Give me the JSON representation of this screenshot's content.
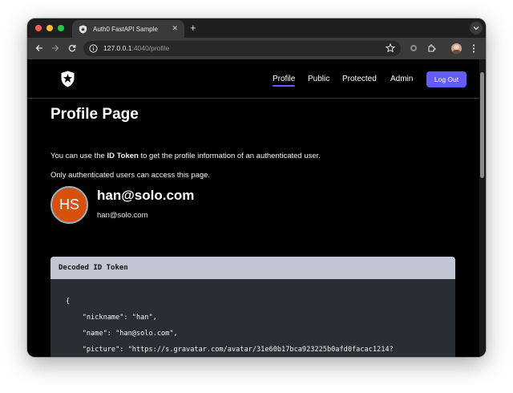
{
  "browser": {
    "tab_title": "Auth0 FastAPI Sample",
    "url_host": "127.0.0.1",
    "url_rest": ":4040/profile"
  },
  "nav": {
    "items": [
      {
        "label": "Profile",
        "active": true
      },
      {
        "label": "Public"
      },
      {
        "label": "Protected"
      },
      {
        "label": "Admin"
      }
    ],
    "logout_label": "Log Out"
  },
  "page": {
    "title": "Profile Page",
    "intro_before": "You can use the ",
    "intro_bold": "ID Token",
    "intro_after": " to get the profile information of an authenticated user.",
    "note": "Only authenticated users can access this page."
  },
  "profile": {
    "initials": "HS",
    "name": "han@solo.com",
    "email": "han@solo.com"
  },
  "token": {
    "header": "Decoded ID Token",
    "lines": [
      "{",
      "    \"nickname\": \"han\",",
      "    \"name\": \"han@solo.com\",",
      "    \"picture\": \"https://s.gravatar.com/avatar/31e60b17bca923225b0afd0facac1214?"
    ]
  },
  "colors": {
    "accent": "#635dff",
    "avatar_bg": "#d94f0c"
  }
}
